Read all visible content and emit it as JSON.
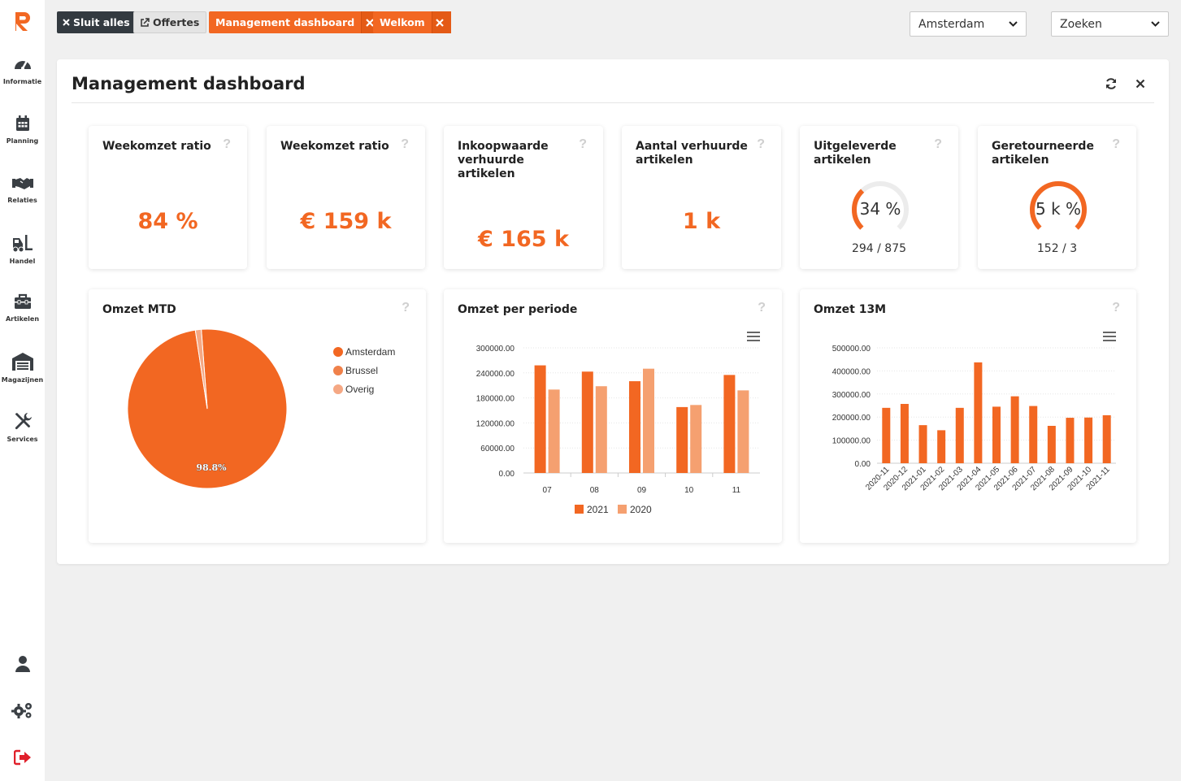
{
  "sidebar": {
    "items": [
      {
        "label": "Informatie",
        "icon": "dashboard-icon"
      },
      {
        "label": "Planning",
        "icon": "calendar-icon"
      },
      {
        "label": "Relaties",
        "icon": "handshake-icon"
      },
      {
        "label": "Handel",
        "icon": "forklift-icon"
      },
      {
        "label": "Artikelen",
        "icon": "toolbox-icon"
      },
      {
        "label": "Magazijnen",
        "icon": "warehouse-icon"
      },
      {
        "label": "Services",
        "icon": "tools-icon"
      }
    ]
  },
  "tabs": {
    "close_all": "Sluit alles",
    "offertes": "Offertes",
    "management": "Management dashboard",
    "welkom": "Welkom"
  },
  "selects": {
    "location": "Amsterdam",
    "search": "Zoeken"
  },
  "panel": {
    "title": "Management dashboard"
  },
  "kpis": [
    {
      "title": "Weekomzet ratio",
      "value": "84 %"
    },
    {
      "title": "Weekomzet ratio",
      "value": "€ 159 k"
    },
    {
      "title": "Inkoopwaarde verhuurde artikelen",
      "value": "€ 165 k"
    },
    {
      "title": "Aantal verhuurde artikelen",
      "value": "1 k"
    }
  ],
  "gauges": [
    {
      "title": "Uitgeleverde artikelen",
      "value": "34 %",
      "fraction": 0.34,
      "sub": "294 / 875"
    },
    {
      "title": "Geretourneerde artikelen",
      "value": "5 k %",
      "fraction": 1.0,
      "sub": "152 / 3"
    }
  ],
  "question_mark": "?",
  "colors": {
    "accent": "#f26722",
    "accent_light": "#f5a070",
    "dark": "#333a40",
    "danger": "#e0202b"
  },
  "chart_data": [
    {
      "type": "pie",
      "title": "Omzet MTD",
      "categories": [
        "Amsterdam",
        "Brussel",
        "Overig"
      ],
      "values": [
        98.8,
        0.0,
        1.2
      ],
      "colors": [
        "#f26722",
        "#f0814a",
        "#f5a884"
      ],
      "data_labels": [
        "98.8%"
      ],
      "legend": "right"
    },
    {
      "type": "bar",
      "title": "Omzet per periode",
      "categories": [
        "07",
        "08",
        "09",
        "10",
        "11"
      ],
      "series": [
        {
          "name": "2021",
          "values": [
            258000,
            243000,
            220000,
            158000,
            235000
          ],
          "color": "#f26722"
        },
        {
          "name": "2020",
          "values": [
            200000,
            208000,
            250000,
            163000,
            198000
          ],
          "color": "#f5a070"
        }
      ],
      "ylim": [
        0,
        300000
      ],
      "yticks": [
        "0.00",
        "60000.00",
        "120000.00",
        "180000.00",
        "240000.00",
        "300000.00"
      ],
      "legend": "bottom"
    },
    {
      "type": "bar",
      "title": "Omzet 13M",
      "categories": [
        "2020-11",
        "2020-12",
        "2021-01",
        "2021-02",
        "2021-03",
        "2021-04",
        "2021-05",
        "2021-06",
        "2021-07",
        "2021-08",
        "2021-09",
        "2021-10",
        "2021-11"
      ],
      "values": [
        240000,
        257000,
        165000,
        143000,
        240000,
        437000,
        245000,
        290000,
        248000,
        162000,
        197000,
        198000,
        208000
      ],
      "color": "#f26722",
      "ylim": [
        0,
        500000
      ],
      "yticks": [
        "0.00",
        "100000.00",
        "200000.00",
        "300000.00",
        "400000.00",
        "500000.00"
      ]
    }
  ]
}
